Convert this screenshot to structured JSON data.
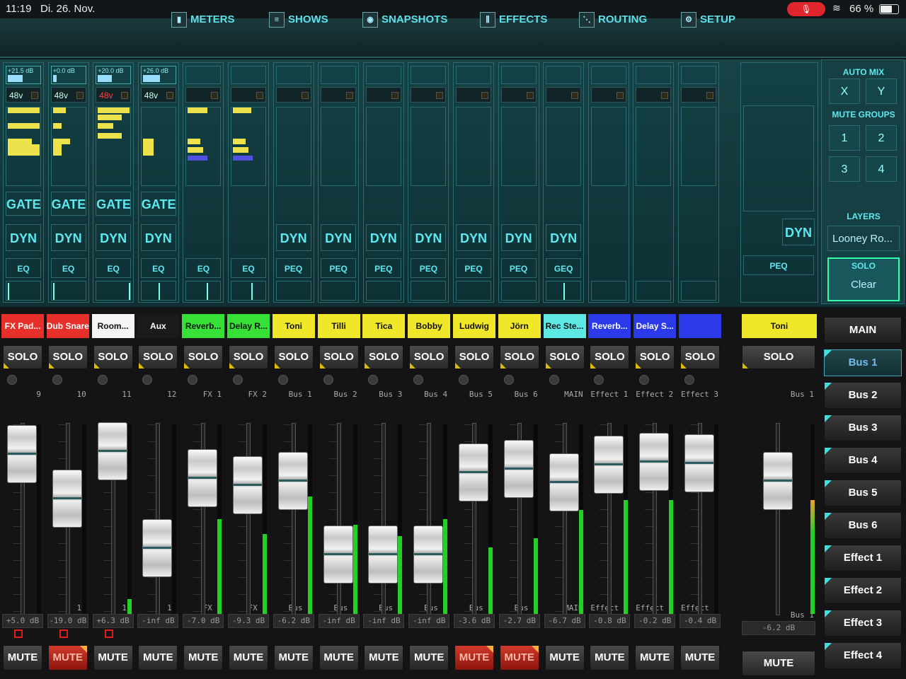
{
  "status": {
    "time": "11:19",
    "date": "Di. 26. Nov.",
    "mic": "🎙",
    "wifi": "≋",
    "battery": "66 %"
  },
  "nav": [
    {
      "label": "METERS",
      "icon": "meters-icon",
      "glyph": "▮"
    },
    {
      "label": "SHOWS",
      "icon": "list-icon",
      "glyph": "≡"
    },
    {
      "label": "SNAPSHOTS",
      "icon": "camera-icon",
      "glyph": "◉"
    },
    {
      "label": "EFFECTS",
      "icon": "sliders-icon",
      "glyph": "⫼"
    },
    {
      "label": "ROUTING",
      "icon": "routing-icon",
      "glyph": "⋱"
    },
    {
      "label": "SETUP",
      "icon": "gear-icon",
      "glyph": "⚙"
    }
  ],
  "strips": [
    {
      "gain": "+21.5 dB",
      "gain_level": 0.48,
      "phantom": "48v",
      "phantom_on": false,
      "gate": "GATE",
      "dyn": "DYN",
      "eq": "EQ",
      "pan": 0.0
    },
    {
      "gain": "+0.0 dB",
      "gain_level": 0.12,
      "phantom": "48v",
      "phantom_on": false,
      "gate": "GATE",
      "dyn": "DYN",
      "eq": "EQ",
      "pan": 0.0
    },
    {
      "gain": "+20.0 dB",
      "gain_level": 0.46,
      "phantom": "48v",
      "phantom_on": true,
      "gate": "GATE",
      "dyn": "DYN",
      "eq": "EQ",
      "pan": 1.0
    },
    {
      "gain": "+26.0 dB",
      "gain_level": 0.54,
      "phantom": "48v",
      "phantom_on": false,
      "gate": "GATE",
      "dyn": "DYN",
      "eq": "EQ",
      "pan": 0.5
    },
    {
      "gain": "",
      "gain_level": 0,
      "phantom": "",
      "gate": "",
      "dyn": "",
      "eq": "EQ",
      "pan": 0.6
    },
    {
      "gain": "",
      "gain_level": 0,
      "phantom": "",
      "gate": "",
      "dyn": "",
      "eq": "EQ",
      "pan": 0.6
    },
    {
      "gain": "",
      "gain_level": 0,
      "phantom": "",
      "gate": "",
      "dyn": "DYN",
      "eq": "PEQ",
      "pan": null
    },
    {
      "gain": "",
      "gain_level": 0,
      "phantom": "",
      "gate": "",
      "dyn": "DYN",
      "eq": "PEQ",
      "pan": null
    },
    {
      "gain": "",
      "gain_level": 0,
      "phantom": "",
      "gate": "",
      "dyn": "DYN",
      "eq": "PEQ",
      "pan": null
    },
    {
      "gain": "",
      "gain_level": 0,
      "phantom": "",
      "gate": "",
      "dyn": "DYN",
      "eq": "PEQ",
      "pan": null
    },
    {
      "gain": "",
      "gain_level": 0,
      "phantom": "",
      "gate": "",
      "dyn": "DYN",
      "eq": "PEQ",
      "pan": null
    },
    {
      "gain": "",
      "gain_level": 0,
      "phantom": "",
      "gate": "",
      "dyn": "DYN",
      "eq": "PEQ",
      "pan": null
    },
    {
      "gain": "",
      "gain_level": 0,
      "phantom": "",
      "gate": "",
      "dyn": "DYN",
      "eq": "GEQ",
      "pan": 0.5
    },
    {
      "gain": "",
      "gain_level": 0,
      "phantom": "",
      "gate": "",
      "dyn": "",
      "eq": "",
      "pan": null
    },
    {
      "gain": "",
      "gain_level": 0,
      "phantom": "",
      "gate": "",
      "dyn": "",
      "eq": "",
      "pan": null
    },
    {
      "gain": "",
      "gain_level": 0,
      "phantom": "",
      "gate": "",
      "dyn": "",
      "eq": "",
      "pan": null
    }
  ],
  "master_strip": {
    "dyn": "DYN",
    "eq": "PEQ"
  },
  "right_panel": {
    "auto_mix": "AUTO MIX",
    "x": "X",
    "y": "Y",
    "mute_groups": "MUTE GROUPS",
    "groups": [
      "1",
      "2",
      "3",
      "4"
    ],
    "layers": "LAYERS",
    "layer_value": "Looney Ro...",
    "solo": "SOLO",
    "clear": "Clear"
  },
  "channels": [
    {
      "name": "FX Pad...",
      "color": "#e8302a",
      "text": "#ffffff",
      "route": "9",
      "db": "+5.0 dB",
      "level": 0.88,
      "meter": 0.0,
      "muted": false,
      "selected": true
    },
    {
      "name": "Dub Snare",
      "color": "#e8302a",
      "text": "#ffffff",
      "route": "10",
      "db": "-19.0 dB",
      "level": 0.55,
      "meter": 0.0,
      "muted": true,
      "selected": true
    },
    {
      "name": "Room...",
      "color": "#f4f4f4",
      "text": "#111111",
      "route": "11",
      "db": "+6.3 dB",
      "level": 0.9,
      "meter": 0.08,
      "muted": false,
      "selected": true
    },
    {
      "name": "Aux",
      "color": "#1a1a1a",
      "text": "#ffffff",
      "route": "12",
      "db": "-inf dB",
      "level": 0.18,
      "meter": 0.0,
      "muted": false,
      "selected": false
    },
    {
      "name": "Reverb...",
      "color": "#36e036",
      "text": "#111111",
      "route": "FX 1",
      "db": "-7.0 dB",
      "level": 0.7,
      "meter": 0.5,
      "muted": false,
      "selected": false
    },
    {
      "name": "Delay R...",
      "color": "#36e036",
      "text": "#111111",
      "route": "FX 2",
      "db": "-9.3 dB",
      "level": 0.65,
      "meter": 0.42,
      "muted": false,
      "selected": false
    },
    {
      "name": "Toni",
      "color": "#f0e62a",
      "text": "#111111",
      "route": "Bus 1",
      "db": "-6.2 dB",
      "level": 0.68,
      "meter": 0.62,
      "muted": false,
      "selected": false
    },
    {
      "name": "Tilli",
      "color": "#f0e62a",
      "text": "#111111",
      "route": "Bus 2",
      "db": "-inf dB",
      "level": 0.13,
      "meter": 0.47,
      "muted": false,
      "selected": false
    },
    {
      "name": "Tica",
      "color": "#f0e62a",
      "text": "#111111",
      "route": "Bus 3",
      "db": "-inf dB",
      "level": 0.13,
      "meter": 0.41,
      "muted": false,
      "selected": false
    },
    {
      "name": "Bobby",
      "color": "#f0e62a",
      "text": "#111111",
      "route": "Bus 4",
      "db": "-inf dB",
      "level": 0.13,
      "meter": 0.5,
      "muted": false,
      "selected": false
    },
    {
      "name": "Ludwig",
      "color": "#f0e62a",
      "text": "#111111",
      "route": "Bus 5",
      "db": "-3.6 dB",
      "level": 0.74,
      "meter": 0.35,
      "muted": true,
      "selected": false
    },
    {
      "name": "Jörn",
      "color": "#f0e62a",
      "text": "#111111",
      "route": "Bus 6",
      "db": "-2.7 dB",
      "level": 0.77,
      "meter": 0.4,
      "muted": true,
      "selected": false
    },
    {
      "name": "Rec Ste...",
      "color": "#5ee8e4",
      "text": "#111111",
      "route": "MAIN",
      "db": "-6.7 dB",
      "level": 0.67,
      "meter": 0.55,
      "muted": false,
      "selected": false
    },
    {
      "name": "Reverb...",
      "color": "#2a3ae8",
      "text": "#ffffff",
      "route": "Effect 1",
      "db": "-0.8 dB",
      "level": 0.8,
      "meter": 0.6,
      "muted": false,
      "selected": false
    },
    {
      "name": "Delay S...",
      "color": "#2a3ae8",
      "text": "#ffffff",
      "route": "Effect 2",
      "db": "-0.2 dB",
      "level": 0.82,
      "meter": 0.6,
      "muted": false,
      "selected": false
    },
    {
      "name": "",
      "color": "#2a3ae8",
      "text": "#ffffff",
      "route": "Effect 3",
      "db": "-0.4 dB",
      "level": 0.81,
      "meter": 0.0,
      "muted": false,
      "selected": false
    }
  ],
  "solo_label": "SOLO",
  "mute_label": "MUTE",
  "master": {
    "name": "Toni",
    "color": "#f0e62a",
    "route": "Bus 1",
    "db": "-6.2 dB",
    "level": 0.68,
    "meter": 0.6
  },
  "buses": [
    {
      "label": "MAIN",
      "active": false
    },
    {
      "label": "Bus 1",
      "active": true
    },
    {
      "label": "Bus 2",
      "active": false
    },
    {
      "label": "Bus 3",
      "active": false
    },
    {
      "label": "Bus 4",
      "active": false
    },
    {
      "label": "Bus 5",
      "active": false
    },
    {
      "label": "Bus 6",
      "active": false
    },
    {
      "label": "Effect 1",
      "active": false
    },
    {
      "label": "Effect 2",
      "active": false
    },
    {
      "label": "Effect 3",
      "active": false
    },
    {
      "label": "Effect 4",
      "active": false
    }
  ]
}
